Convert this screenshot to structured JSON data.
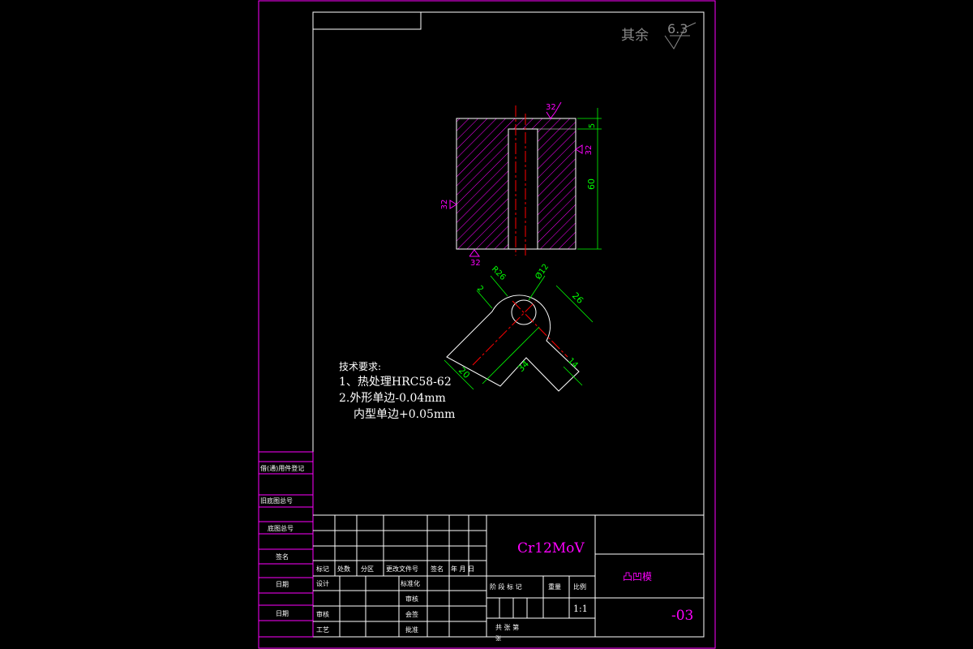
{
  "colors": {
    "background": "#000000",
    "frame": "#ff00ff",
    "border": "#ffffff",
    "hatch": "#ff00ff",
    "outline": "#ffffff",
    "dimension": "#00ff00",
    "centerline": "#ff0000",
    "roughness": "#ff00ff",
    "text_white": "#ffffff",
    "text_magenta": "#ff00ff",
    "text_green": "#00ff00",
    "roughness_note": "#888888"
  },
  "roughness_note": {
    "label": "其余",
    "value": "6.3"
  },
  "front_view": {
    "roughness_marks": [
      "32",
      "32",
      "32",
      "32"
    ],
    "dimensions": {
      "top_depth": "5",
      "height": "60"
    }
  },
  "top_view": {
    "dimensions": {
      "outer_radius": "R26",
      "hole_dia": "Ø12",
      "arm_width": "26",
      "arm_end": "14",
      "arm_length": "34",
      "bottom_width": "20",
      "small": "2"
    }
  },
  "tech_requirements": {
    "title": "技术要求:",
    "items": [
      "1、热处理HRC58-62",
      "2.外形单边-0.04mm",
      "内型单边+0.05mm"
    ]
  },
  "left_strip": {
    "labels": [
      "借(通)用件登记",
      "旧底图总号",
      "底图总号",
      "签名",
      "日期",
      "日期"
    ]
  },
  "title_block": {
    "material": "Cr12MoV",
    "part_name": "凸凹模",
    "drawing_number": "-03",
    "scale_label": "比例",
    "weight_label": "重量",
    "scale": "1:1",
    "stage_header": "阶 段 标 记",
    "sheets": "共    张   第",
    "sheet_extra": "张",
    "revision_headers": [
      "标记",
      "处数",
      "分区",
      "更改文件号",
      "签名",
      "年 月 日"
    ],
    "sign_rows": [
      {
        "left": "设计",
        "mid": "标准化"
      },
      {
        "left": "",
        "mid": "审核"
      },
      {
        "left": "审核",
        "mid": "会签"
      },
      {
        "left": "工艺",
        "mid": "批准"
      }
    ]
  }
}
